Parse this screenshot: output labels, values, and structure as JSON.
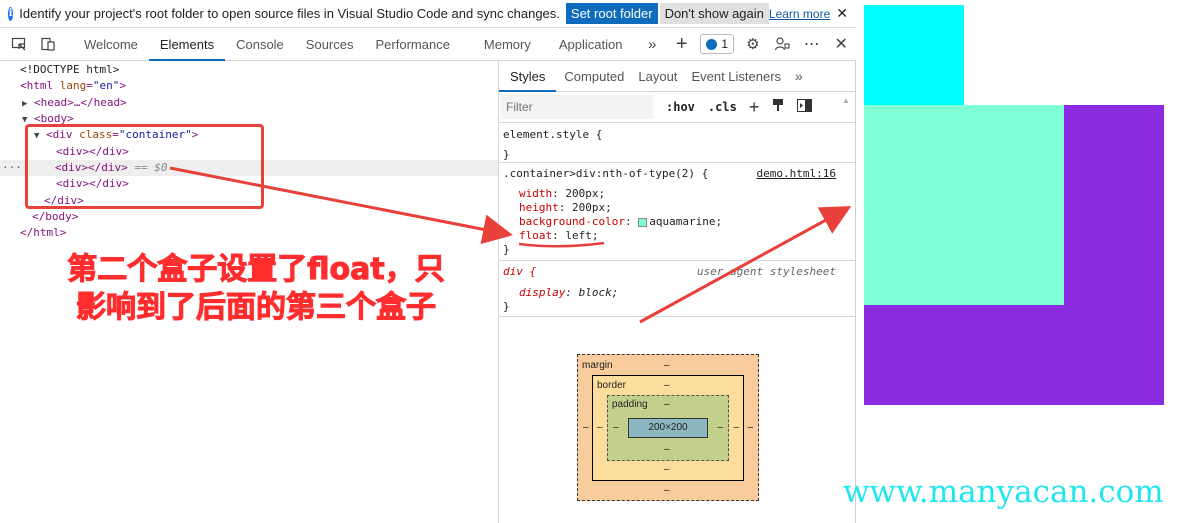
{
  "infobar": {
    "message": "Identify your project's root folder to open source files in Visual Studio Code and sync changes.",
    "set_root_label": "Set root folder",
    "dont_show_label": "Don't show again",
    "learn_more_label": "Learn more"
  },
  "tabs": [
    "Welcome",
    "Elements",
    "Console",
    "Sources",
    "Performance",
    "Memory",
    "Application"
  ],
  "active_tab": "Elements",
  "issues_count": "1",
  "dom": {
    "doctype": "<!DOCTYPE html>",
    "html_open": "<html",
    "html_attr_name": "lang",
    "html_attr_value": "\"en\"",
    "head": "<head>…</head>",
    "body_open": "<body>",
    "div_open": "<div",
    "div_attr_name": "class",
    "div_attr_value": "\"container\"",
    "child_div": "<div></div>",
    "selected_hint": "== $0",
    "div_close": "</div>",
    "body_close": "</body>",
    "html_close": "</html>"
  },
  "annotation": {
    "line1": "第二个盒子设置了float，只",
    "line2": "影响到了后面的第三个盒子"
  },
  "styles": {
    "tabs": [
      "Styles",
      "Computed",
      "Layout",
      "Event Listeners"
    ],
    "filter_placeholder": "Filter",
    "hov": ":hov",
    "cls": ".cls",
    "element_style": "element.style {",
    "close_brace": "}",
    "rule_selector": ".container>div:nth-of-type(2) {",
    "rule_source": "demo.html:16",
    "props": [
      {
        "name": "width",
        "value": "200px;"
      },
      {
        "name": "height",
        "value": "200px;"
      },
      {
        "name": "background-color",
        "value": "aquamarine;"
      },
      {
        "name": "float",
        "value": "left;"
      }
    ],
    "ua_selector": "div {",
    "ua_source": "user agent stylesheet",
    "ua_prop_name": "display",
    "ua_prop_value": "block;"
  },
  "box_model": {
    "margin_label": "margin",
    "border_label": "border",
    "padding_label": "padding",
    "dash": "–",
    "content_size": "200×200"
  },
  "preview": {
    "box1_color": "#00ffff",
    "box2_color": "#7fffd4",
    "box3_color": "#8a2be2"
  },
  "watermark": "www.manyacan.com",
  "colors": {
    "accent": "#0f6cbd",
    "annotation_red": "#ff2d2d",
    "swatch_aquamarine": "#7fffd4"
  }
}
